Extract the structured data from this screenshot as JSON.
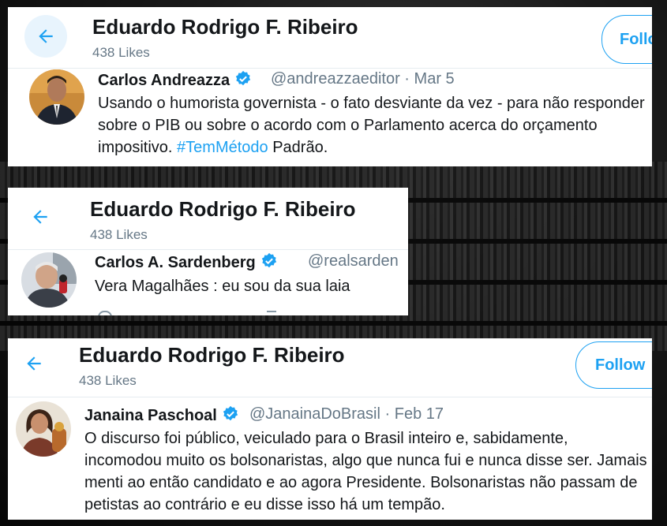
{
  "profile": {
    "name": "Eduardo Rodrigo F. Ribeiro",
    "likes": "438 Likes",
    "follow_label": "Follow"
  },
  "tweets": [
    {
      "author": "Carlos Andreazza",
      "handle": "@andreazzaeditor",
      "date": "Mar 5",
      "text_before": "Usando o humorista governista - o fato desviante da vez - para não responder sobre o PIB ou sobre o acordo com o Parlamento acerca do orçamento impositivo. ",
      "hashtag": "#TemMétodo",
      "text_after": " Padrão."
    },
    {
      "author": "Carlos A. Sardenberg",
      "handle": "@realsarden",
      "text": "Vera Magalhães : eu sou da sua laia"
    },
    {
      "author": "Janaina Paschoal",
      "handle": "@JanainaDoBrasil",
      "date": "Feb 17",
      "text": "O discurso foi público, veiculado para o Brasil inteiro e, sabidamente, incomodou muito os bolsonaristas, algo que nunca fui e nunca disse ser. Jamais menti ao então candidato e ao agora Presidente. Bolsonaristas não passam de petistas ao contrário e eu disse isso  há um tempão."
    }
  ],
  "separator": "·",
  "icons": [
    "back-arrow-icon",
    "verified-badge-icon"
  ],
  "colors": {
    "accent": "#1da1f2",
    "text": "#14171a",
    "muted": "#657786"
  }
}
